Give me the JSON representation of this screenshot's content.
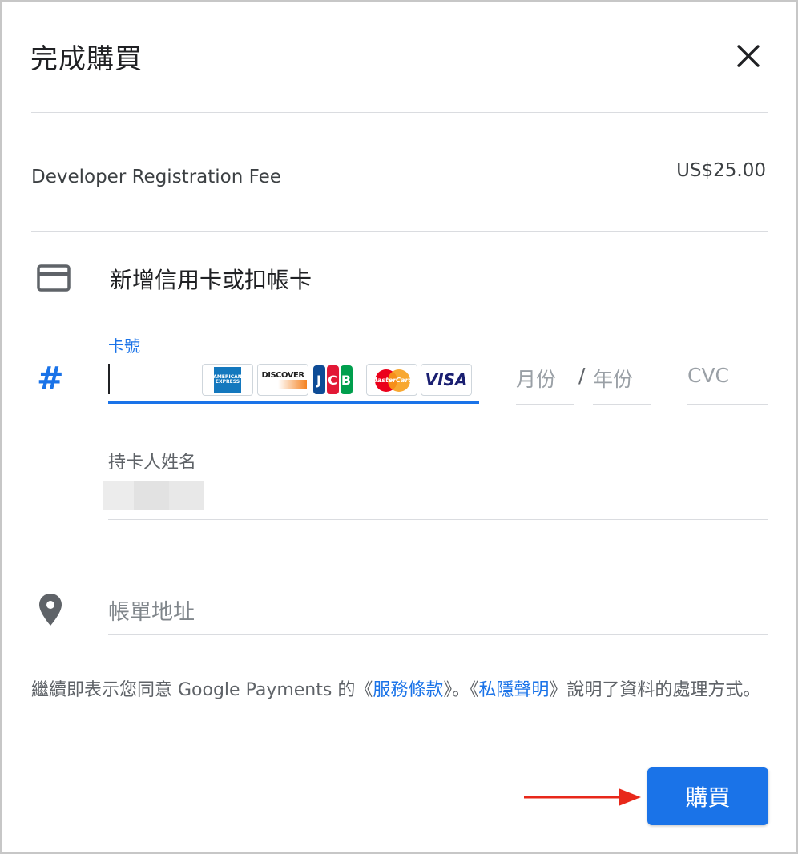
{
  "dialog": {
    "title": "完成購買",
    "close_icon": "close-icon"
  },
  "order": {
    "item_name": "Developer Registration Fee",
    "price": "US$25.00"
  },
  "payment": {
    "card_icon": "credit-card-icon",
    "add_card_label": "新增信用卡或扣帳卡",
    "card_number": {
      "icon": "hash-icon",
      "label": "卡號",
      "value": "",
      "brands": [
        "American Express",
        "DISCOVER",
        "JCB",
        "MasterCard",
        "VISA"
      ]
    },
    "month_placeholder": "月份",
    "separator": "/",
    "year_placeholder": "年份",
    "cvc_placeholder": "CVC",
    "cardholder": {
      "label": "持卡人姓名"
    },
    "billing": {
      "icon": "location-pin-icon",
      "placeholder": "帳單地址"
    }
  },
  "terms": {
    "prefix": "繼續即表示您同意 Google Payments 的《",
    "terms_link": "服務條款",
    "middle": "》。《",
    "privacy_link": "私隱聲明",
    "suffix": "》說明了資料的處理方式。"
  },
  "actions": {
    "buy_label": "購買"
  },
  "colors": {
    "accent": "#1a73e8",
    "arrow": "#e8281a"
  }
}
